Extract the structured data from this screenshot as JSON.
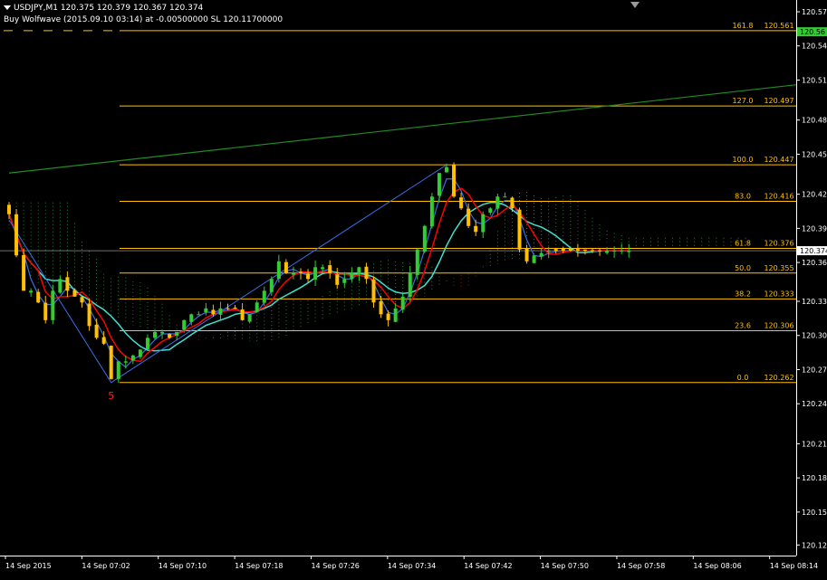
{
  "header": {
    "symbol_line": "USDJPY,M1  120.375 120.379 120.367 120.374",
    "indicator_line": "Buy Wolfwave (2015.09.10 03:14) at -0.00500000 SL 120.11700000"
  },
  "colors": {
    "background": "#000000",
    "bull_candle": "#32cd32",
    "bear_candle": "#ffc000",
    "fib_line": "#ffc000",
    "trend_line": "#228b22",
    "red_ma": "#ff0000",
    "cyan_ma": "#40e0d0",
    "blue_ma": "#3a6ee8",
    "yellow_line": "#ffd700",
    "price_tag": "#32cd32"
  },
  "chart_data": {
    "type": "candlestick",
    "symbol": "USDJPY",
    "timeframe": "M1",
    "ylim": [
      120.115,
      120.587
    ],
    "y_ticks": [
      120.577,
      120.548,
      120.519,
      120.485,
      120.456,
      120.422,
      120.393,
      120.364,
      120.331,
      120.302,
      120.273,
      120.244,
      120.21,
      120.181,
      120.152,
      120.124
    ],
    "x_labels": [
      "14 Sep 2015",
      "14 Sep 07:02",
      "14 Sep 07:10",
      "14 Sep 07:18",
      "14 Sep 07:26",
      "14 Sep 07:34",
      "14 Sep 07:42",
      "14 Sep 07:50",
      "14 Sep 07:58",
      "14 Sep 08:06",
      "14 Sep 08:14"
    ],
    "candle_count": 86,
    "last_price": "120.56",
    "bid_price": "120.374",
    "wave_label": "5",
    "fib_levels": [
      {
        "ratio": "161.8",
        "price": "120.561"
      },
      {
        "ratio": "127.0",
        "price": "120.497"
      },
      {
        "ratio": "100.0",
        "price": "120.447"
      },
      {
        "ratio": "83.0",
        "price": "120.416"
      },
      {
        "ratio": "61.8",
        "price": "120.376"
      },
      {
        "ratio": "50.0",
        "price": "120.355"
      },
      {
        "ratio": "38.2",
        "price": "120.333"
      },
      {
        "ratio": "23.6",
        "price": "120.306"
      },
      {
        "ratio": "0.0",
        "price": "120.262"
      }
    ],
    "trend_line": {
      "start": {
        "bar": 0,
        "price": 120.44
      },
      "end": {
        "bar": 85,
        "price": 120.515
      }
    },
    "closes": [
      120.405,
      120.37,
      120.34,
      120.34,
      120.33,
      120.315,
      120.34,
      120.35,
      120.34,
      120.335,
      120.33,
      120.31,
      120.3,
      120.295,
      120.265,
      120.28,
      120.28,
      120.285,
      120.29,
      120.3,
      120.305,
      120.305,
      120.3,
      120.305,
      120.315,
      120.32,
      120.32,
      120.325,
      120.32,
      120.325,
      120.325,
      120.325,
      120.315,
      120.32,
      120.33,
      120.34,
      120.35,
      120.365,
      120.355,
      120.355,
      120.355,
      120.35,
      120.36,
      120.36,
      120.355,
      120.345,
      120.35,
      120.355,
      120.36,
      120.35,
      120.33,
      120.32,
      120.315,
      120.325,
      120.335,
      120.355,
      120.375,
      120.395,
      120.42,
      120.44,
      120.445,
      120.42,
      120.41,
      120.395,
      120.39,
      120.405,
      120.41,
      120.42,
      120.42,
      120.41,
      120.375,
      120.365,
      120.37,
      120.372,
      120.374
    ]
  }
}
